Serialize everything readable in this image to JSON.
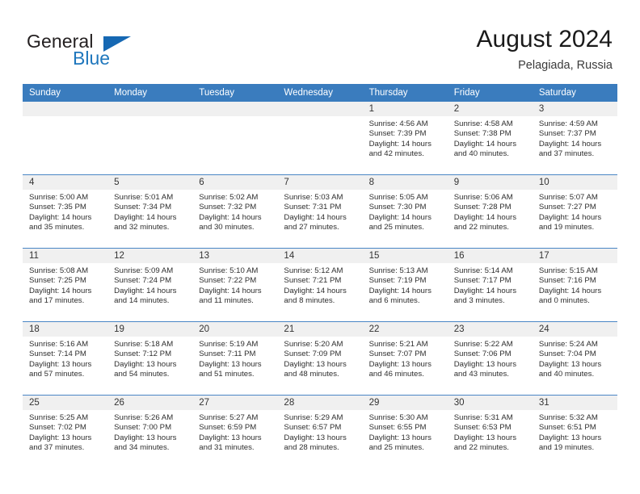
{
  "brand": {
    "name_part1": "General",
    "name_part2": "Blue",
    "triangle_icon": "triangle-icon",
    "accent_color": "#1668b3"
  },
  "header": {
    "title": "August 2024",
    "subtitle": "Pelagiada, Russia"
  },
  "calendar": {
    "header_bg": "#3a7cbe",
    "daynum_bg": "#f0f0f0",
    "weekday_headers": [
      "Sunday",
      "Monday",
      "Tuesday",
      "Wednesday",
      "Thursday",
      "Friday",
      "Saturday"
    ],
    "weeks": [
      [
        {
          "day": "",
          "sunrise": "",
          "sunset": "",
          "daylight_1": "",
          "daylight_2": ""
        },
        {
          "day": "",
          "sunrise": "",
          "sunset": "",
          "daylight_1": "",
          "daylight_2": ""
        },
        {
          "day": "",
          "sunrise": "",
          "sunset": "",
          "daylight_1": "",
          "daylight_2": ""
        },
        {
          "day": "",
          "sunrise": "",
          "sunset": "",
          "daylight_1": "",
          "daylight_2": ""
        },
        {
          "day": "1",
          "sunrise": "Sunrise: 4:56 AM",
          "sunset": "Sunset: 7:39 PM",
          "daylight_1": "Daylight: 14 hours",
          "daylight_2": "and 42 minutes."
        },
        {
          "day": "2",
          "sunrise": "Sunrise: 4:58 AM",
          "sunset": "Sunset: 7:38 PM",
          "daylight_1": "Daylight: 14 hours",
          "daylight_2": "and 40 minutes."
        },
        {
          "day": "3",
          "sunrise": "Sunrise: 4:59 AM",
          "sunset": "Sunset: 7:37 PM",
          "daylight_1": "Daylight: 14 hours",
          "daylight_2": "and 37 minutes."
        }
      ],
      [
        {
          "day": "4",
          "sunrise": "Sunrise: 5:00 AM",
          "sunset": "Sunset: 7:35 PM",
          "daylight_1": "Daylight: 14 hours",
          "daylight_2": "and 35 minutes."
        },
        {
          "day": "5",
          "sunrise": "Sunrise: 5:01 AM",
          "sunset": "Sunset: 7:34 PM",
          "daylight_1": "Daylight: 14 hours",
          "daylight_2": "and 32 minutes."
        },
        {
          "day": "6",
          "sunrise": "Sunrise: 5:02 AM",
          "sunset": "Sunset: 7:32 PM",
          "daylight_1": "Daylight: 14 hours",
          "daylight_2": "and 30 minutes."
        },
        {
          "day": "7",
          "sunrise": "Sunrise: 5:03 AM",
          "sunset": "Sunset: 7:31 PM",
          "daylight_1": "Daylight: 14 hours",
          "daylight_2": "and 27 minutes."
        },
        {
          "day": "8",
          "sunrise": "Sunrise: 5:05 AM",
          "sunset": "Sunset: 7:30 PM",
          "daylight_1": "Daylight: 14 hours",
          "daylight_2": "and 25 minutes."
        },
        {
          "day": "9",
          "sunrise": "Sunrise: 5:06 AM",
          "sunset": "Sunset: 7:28 PM",
          "daylight_1": "Daylight: 14 hours",
          "daylight_2": "and 22 minutes."
        },
        {
          "day": "10",
          "sunrise": "Sunrise: 5:07 AM",
          "sunset": "Sunset: 7:27 PM",
          "daylight_1": "Daylight: 14 hours",
          "daylight_2": "and 19 minutes."
        }
      ],
      [
        {
          "day": "11",
          "sunrise": "Sunrise: 5:08 AM",
          "sunset": "Sunset: 7:25 PM",
          "daylight_1": "Daylight: 14 hours",
          "daylight_2": "and 17 minutes."
        },
        {
          "day": "12",
          "sunrise": "Sunrise: 5:09 AM",
          "sunset": "Sunset: 7:24 PM",
          "daylight_1": "Daylight: 14 hours",
          "daylight_2": "and 14 minutes."
        },
        {
          "day": "13",
          "sunrise": "Sunrise: 5:10 AM",
          "sunset": "Sunset: 7:22 PM",
          "daylight_1": "Daylight: 14 hours",
          "daylight_2": "and 11 minutes."
        },
        {
          "day": "14",
          "sunrise": "Sunrise: 5:12 AM",
          "sunset": "Sunset: 7:21 PM",
          "daylight_1": "Daylight: 14 hours",
          "daylight_2": "and 8 minutes."
        },
        {
          "day": "15",
          "sunrise": "Sunrise: 5:13 AM",
          "sunset": "Sunset: 7:19 PM",
          "daylight_1": "Daylight: 14 hours",
          "daylight_2": "and 6 minutes."
        },
        {
          "day": "16",
          "sunrise": "Sunrise: 5:14 AM",
          "sunset": "Sunset: 7:17 PM",
          "daylight_1": "Daylight: 14 hours",
          "daylight_2": "and 3 minutes."
        },
        {
          "day": "17",
          "sunrise": "Sunrise: 5:15 AM",
          "sunset": "Sunset: 7:16 PM",
          "daylight_1": "Daylight: 14 hours",
          "daylight_2": "and 0 minutes."
        }
      ],
      [
        {
          "day": "18",
          "sunrise": "Sunrise: 5:16 AM",
          "sunset": "Sunset: 7:14 PM",
          "daylight_1": "Daylight: 13 hours",
          "daylight_2": "and 57 minutes."
        },
        {
          "day": "19",
          "sunrise": "Sunrise: 5:18 AM",
          "sunset": "Sunset: 7:12 PM",
          "daylight_1": "Daylight: 13 hours",
          "daylight_2": "and 54 minutes."
        },
        {
          "day": "20",
          "sunrise": "Sunrise: 5:19 AM",
          "sunset": "Sunset: 7:11 PM",
          "daylight_1": "Daylight: 13 hours",
          "daylight_2": "and 51 minutes."
        },
        {
          "day": "21",
          "sunrise": "Sunrise: 5:20 AM",
          "sunset": "Sunset: 7:09 PM",
          "daylight_1": "Daylight: 13 hours",
          "daylight_2": "and 48 minutes."
        },
        {
          "day": "22",
          "sunrise": "Sunrise: 5:21 AM",
          "sunset": "Sunset: 7:07 PM",
          "daylight_1": "Daylight: 13 hours",
          "daylight_2": "and 46 minutes."
        },
        {
          "day": "23",
          "sunrise": "Sunrise: 5:22 AM",
          "sunset": "Sunset: 7:06 PM",
          "daylight_1": "Daylight: 13 hours",
          "daylight_2": "and 43 minutes."
        },
        {
          "day": "24",
          "sunrise": "Sunrise: 5:24 AM",
          "sunset": "Sunset: 7:04 PM",
          "daylight_1": "Daylight: 13 hours",
          "daylight_2": "and 40 minutes."
        }
      ],
      [
        {
          "day": "25",
          "sunrise": "Sunrise: 5:25 AM",
          "sunset": "Sunset: 7:02 PM",
          "daylight_1": "Daylight: 13 hours",
          "daylight_2": "and 37 minutes."
        },
        {
          "day": "26",
          "sunrise": "Sunrise: 5:26 AM",
          "sunset": "Sunset: 7:00 PM",
          "daylight_1": "Daylight: 13 hours",
          "daylight_2": "and 34 minutes."
        },
        {
          "day": "27",
          "sunrise": "Sunrise: 5:27 AM",
          "sunset": "Sunset: 6:59 PM",
          "daylight_1": "Daylight: 13 hours",
          "daylight_2": "and 31 minutes."
        },
        {
          "day": "28",
          "sunrise": "Sunrise: 5:29 AM",
          "sunset": "Sunset: 6:57 PM",
          "daylight_1": "Daylight: 13 hours",
          "daylight_2": "and 28 minutes."
        },
        {
          "day": "29",
          "sunrise": "Sunrise: 5:30 AM",
          "sunset": "Sunset: 6:55 PM",
          "daylight_1": "Daylight: 13 hours",
          "daylight_2": "and 25 minutes."
        },
        {
          "day": "30",
          "sunrise": "Sunrise: 5:31 AM",
          "sunset": "Sunset: 6:53 PM",
          "daylight_1": "Daylight: 13 hours",
          "daylight_2": "and 22 minutes."
        },
        {
          "day": "31",
          "sunrise": "Sunrise: 5:32 AM",
          "sunset": "Sunset: 6:51 PM",
          "daylight_1": "Daylight: 13 hours",
          "daylight_2": "and 19 minutes."
        }
      ]
    ]
  }
}
